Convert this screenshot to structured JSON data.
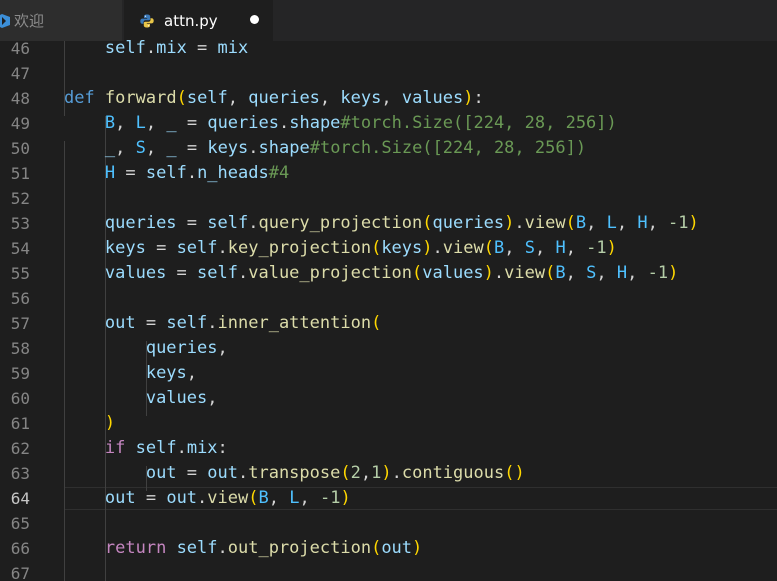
{
  "tabs": [
    {
      "label": "欢迎",
      "active": false
    },
    {
      "label": "attn.py",
      "active": true,
      "dirty": true
    }
  ],
  "editor": {
    "active_line": 64,
    "line_numbers": [
      "46",
      "47",
      "48",
      "49",
      "50",
      "51",
      "52",
      "53",
      "54",
      "55",
      "56",
      "57",
      "58",
      "59",
      "60",
      "61",
      "62",
      "63",
      "64",
      "65",
      "66",
      "67"
    ],
    "lines": [
      [
        {
          "t": "        "
        },
        {
          "t": "self",
          "c": "v"
        },
        {
          "t": "."
        },
        {
          "t": "mix",
          "c": "v"
        },
        {
          "t": " = "
        },
        {
          "t": "mix",
          "c": "v"
        }
      ],
      [],
      [
        {
          "t": "    "
        },
        {
          "t": "def",
          "c": "k"
        },
        {
          "t": " "
        },
        {
          "t": "forward",
          "c": "f"
        },
        {
          "t": "(",
          "c": "b1"
        },
        {
          "t": "self",
          "c": "v"
        },
        {
          "t": ", "
        },
        {
          "t": "queries",
          "c": "v"
        },
        {
          "t": ", "
        },
        {
          "t": "keys",
          "c": "v"
        },
        {
          "t": ", "
        },
        {
          "t": "values",
          "c": "v"
        },
        {
          "t": ")",
          "c": "b1"
        },
        {
          "t": ":"
        }
      ],
      [
        {
          "t": "        "
        },
        {
          "t": "B",
          "c": "c"
        },
        {
          "t": ", "
        },
        {
          "t": "L",
          "c": "c"
        },
        {
          "t": ", "
        },
        {
          "t": "_",
          "c": "v"
        },
        {
          "t": " = "
        },
        {
          "t": "queries",
          "c": "v"
        },
        {
          "t": "."
        },
        {
          "t": "shape",
          "c": "v"
        },
        {
          "t": "#torch.Size([224, 28, 256])",
          "c": "cm"
        }
      ],
      [
        {
          "t": "        "
        },
        {
          "t": "_",
          "c": "v"
        },
        {
          "t": ", "
        },
        {
          "t": "S",
          "c": "c"
        },
        {
          "t": ", "
        },
        {
          "t": "_",
          "c": "v"
        },
        {
          "t": " = "
        },
        {
          "t": "keys",
          "c": "v"
        },
        {
          "t": "."
        },
        {
          "t": "shape",
          "c": "v"
        },
        {
          "t": "#torch.Size([224, 28, 256])",
          "c": "cm"
        }
      ],
      [
        {
          "t": "        "
        },
        {
          "t": "H",
          "c": "c"
        },
        {
          "t": " = "
        },
        {
          "t": "self",
          "c": "v"
        },
        {
          "t": "."
        },
        {
          "t": "n_heads",
          "c": "v"
        },
        {
          "t": "#4",
          "c": "cm"
        }
      ],
      [],
      [
        {
          "t": "        "
        },
        {
          "t": "queries",
          "c": "v"
        },
        {
          "t": " = "
        },
        {
          "t": "self",
          "c": "v"
        },
        {
          "t": "."
        },
        {
          "t": "query_projection",
          "c": "f"
        },
        {
          "t": "(",
          "c": "b1"
        },
        {
          "t": "queries",
          "c": "v"
        },
        {
          "t": ")",
          "c": "b1"
        },
        {
          "t": "."
        },
        {
          "t": "view",
          "c": "f"
        },
        {
          "t": "(",
          "c": "b1"
        },
        {
          "t": "B",
          "c": "c"
        },
        {
          "t": ", "
        },
        {
          "t": "L",
          "c": "c"
        },
        {
          "t": ", "
        },
        {
          "t": "H",
          "c": "c"
        },
        {
          "t": ", "
        },
        {
          "t": "-1",
          "c": "n"
        },
        {
          "t": ")",
          "c": "b1"
        }
      ],
      [
        {
          "t": "        "
        },
        {
          "t": "keys",
          "c": "v"
        },
        {
          "t": " = "
        },
        {
          "t": "self",
          "c": "v"
        },
        {
          "t": "."
        },
        {
          "t": "key_projection",
          "c": "f"
        },
        {
          "t": "(",
          "c": "b1"
        },
        {
          "t": "keys",
          "c": "v"
        },
        {
          "t": ")",
          "c": "b1"
        },
        {
          "t": "."
        },
        {
          "t": "view",
          "c": "f"
        },
        {
          "t": "(",
          "c": "b1"
        },
        {
          "t": "B",
          "c": "c"
        },
        {
          "t": ", "
        },
        {
          "t": "S",
          "c": "c"
        },
        {
          "t": ", "
        },
        {
          "t": "H",
          "c": "c"
        },
        {
          "t": ", "
        },
        {
          "t": "-1",
          "c": "n"
        },
        {
          "t": ")",
          "c": "b1"
        }
      ],
      [
        {
          "t": "        "
        },
        {
          "t": "values",
          "c": "v"
        },
        {
          "t": " = "
        },
        {
          "t": "self",
          "c": "v"
        },
        {
          "t": "."
        },
        {
          "t": "value_projection",
          "c": "f"
        },
        {
          "t": "(",
          "c": "b1"
        },
        {
          "t": "values",
          "c": "v"
        },
        {
          "t": ")",
          "c": "b1"
        },
        {
          "t": "."
        },
        {
          "t": "view",
          "c": "f"
        },
        {
          "t": "(",
          "c": "b1"
        },
        {
          "t": "B",
          "c": "c"
        },
        {
          "t": ", "
        },
        {
          "t": "S",
          "c": "c"
        },
        {
          "t": ", "
        },
        {
          "t": "H",
          "c": "c"
        },
        {
          "t": ", "
        },
        {
          "t": "-1",
          "c": "n"
        },
        {
          "t": ")",
          "c": "b1"
        }
      ],
      [],
      [
        {
          "t": "        "
        },
        {
          "t": "out",
          "c": "v"
        },
        {
          "t": " = "
        },
        {
          "t": "self",
          "c": "v"
        },
        {
          "t": "."
        },
        {
          "t": "inner_attention",
          "c": "f"
        },
        {
          "t": "(",
          "c": "b1"
        }
      ],
      [
        {
          "t": "            "
        },
        {
          "t": "queries",
          "c": "v"
        },
        {
          "t": ","
        }
      ],
      [
        {
          "t": "            "
        },
        {
          "t": "keys",
          "c": "v"
        },
        {
          "t": ","
        }
      ],
      [
        {
          "t": "            "
        },
        {
          "t": "values",
          "c": "v"
        },
        {
          "t": ","
        }
      ],
      [
        {
          "t": "        "
        },
        {
          "t": ")",
          "c": "b1"
        }
      ],
      [
        {
          "t": "        "
        },
        {
          "t": "if",
          "c": "kc"
        },
        {
          "t": " "
        },
        {
          "t": "self",
          "c": "v"
        },
        {
          "t": "."
        },
        {
          "t": "mix",
          "c": "v"
        },
        {
          "t": ":"
        }
      ],
      [
        {
          "t": "            "
        },
        {
          "t": "out",
          "c": "v"
        },
        {
          "t": " = "
        },
        {
          "t": "out",
          "c": "v"
        },
        {
          "t": "."
        },
        {
          "t": "transpose",
          "c": "f"
        },
        {
          "t": "(",
          "c": "b1"
        },
        {
          "t": "2",
          "c": "n"
        },
        {
          "t": ","
        },
        {
          "t": "1",
          "c": "n"
        },
        {
          "t": ")",
          "c": "b1"
        },
        {
          "t": "."
        },
        {
          "t": "contiguous",
          "c": "f"
        },
        {
          "t": "()",
          "c": "b1"
        }
      ],
      [
        {
          "t": "        "
        },
        {
          "t": "out",
          "c": "v"
        },
        {
          "t": " = "
        },
        {
          "t": "out",
          "c": "v"
        },
        {
          "t": "."
        },
        {
          "t": "view",
          "c": "f"
        },
        {
          "t": "(",
          "c": "b1"
        },
        {
          "t": "B",
          "c": "c"
        },
        {
          "t": ", "
        },
        {
          "t": "L",
          "c": "c"
        },
        {
          "t": ", "
        },
        {
          "t": "-1",
          "c": "n"
        },
        {
          "t": ")",
          "c": "b1"
        }
      ],
      [],
      [
        {
          "t": "        "
        },
        {
          "t": "return",
          "c": "kc"
        },
        {
          "t": " "
        },
        {
          "t": "self",
          "c": "v"
        },
        {
          "t": "."
        },
        {
          "t": "out_projection",
          "c": "f"
        },
        {
          "t": "(",
          "c": "b1"
        },
        {
          "t": "out",
          "c": "v"
        },
        {
          "t": ")",
          "c": "b1"
        }
      ],
      []
    ]
  },
  "icons": {
    "welcome_tab": "vscode-logo-icon",
    "attn_tab": "python-file-icon",
    "dirty": "unsaved-dot-icon"
  },
  "colors": {
    "editor_bg": "#1e1e1e",
    "tab_bar_bg": "#252526",
    "keyword": "#569cd6",
    "control_keyword": "#c586c0",
    "function": "#dcdcaa",
    "variable": "#9cdcfe",
    "constant": "#4fc1ff",
    "number": "#b5cea8",
    "comment": "#6a9955",
    "bracket": "#ffd700"
  }
}
